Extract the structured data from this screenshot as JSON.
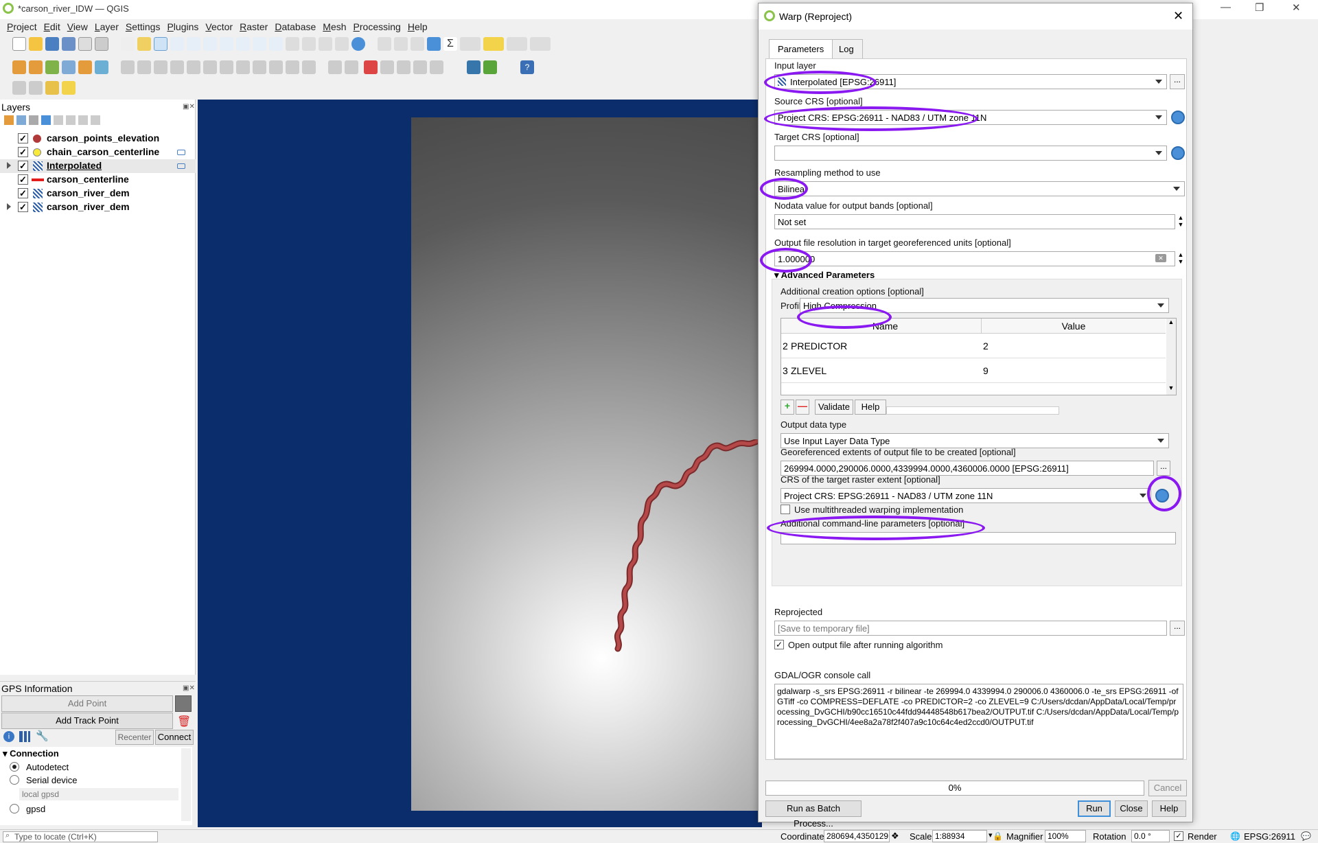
{
  "window": {
    "title": "*carson_river_IDW — QGIS"
  },
  "menubar": [
    "Project",
    "Edit",
    "View",
    "Layer",
    "Settings",
    "Plugins",
    "Vector",
    "Raster",
    "Database",
    "Mesh",
    "Processing",
    "Help"
  ],
  "layers_panel": {
    "title": "Layers",
    "items": [
      {
        "label": "carson_points_elevation",
        "checked": "✓",
        "symbol": "point-red-icon"
      },
      {
        "label": "chain_carson_centerline",
        "checked": "✓",
        "symbol": "point-yellow-icon"
      },
      {
        "label": "Interpolated",
        "checked": "✓",
        "symbol": "raster-icon"
      },
      {
        "label": "carson_centerline",
        "checked": "✓",
        "symbol": "line-red-icon"
      },
      {
        "label": "carson_river_dem",
        "checked": "✓",
        "symbol": "raster-icon"
      },
      {
        "label": "carson_river_dem",
        "checked": "✓",
        "symbol": "raster-icon"
      }
    ]
  },
  "gps_panel": {
    "title": "GPS Information",
    "add_point": "Add Point",
    "add_track_point": "Add Track Point",
    "recenter": "Recenter",
    "connect": "Connect",
    "connection_header": "Connection",
    "autodetect": "Autodetect",
    "serial_device": "Serial device",
    "local_gpsd": "local gpsd",
    "gpsd": "gpsd"
  },
  "statusbar": {
    "locate_placeholder": "Type to locate (Ctrl+K)",
    "coordinate_label": "Coordinate",
    "coordinate_value": "280694,4350129",
    "scale_label": "Scale",
    "scale_value": "1:88934",
    "magnifier_label": "Magnifier",
    "magnifier_value": "100%",
    "rotation_label": "Rotation",
    "rotation_value": "0.0 °",
    "render_label": "Render",
    "crs": "EPSG:26911"
  },
  "dialog": {
    "title": "Warp (Reproject)",
    "tabs": [
      "Parameters",
      "Log"
    ],
    "input_layer_label": "Input layer",
    "input_layer_value": "Interpolated [EPSG:26911]",
    "source_crs_label": "Source CRS [optional]",
    "source_crs_value": "Project CRS: EPSG:26911 - NAD83 / UTM zone 11N",
    "target_crs_label": "Target CRS [optional]",
    "target_crs_value": "",
    "resampling_label": "Resampling method to use",
    "resampling_value": "Bilinear",
    "nodata_label": "Nodata value for output bands [optional]",
    "nodata_value": "Not set",
    "resolution_label": "Output file resolution in target georeferenced units [optional]",
    "resolution_value": "1.000000",
    "advanced_label": "Advanced Parameters",
    "creation_options_label": "Additional creation options [optional]",
    "profile_label": "Profile",
    "profile_value": "High Compression",
    "table_headers": [
      "Name",
      "Value"
    ],
    "table_rows": [
      {
        "idx": "2",
        "name": "PREDICTOR",
        "value": "2"
      },
      {
        "idx": "3",
        "name": "ZLEVEL",
        "value": "9"
      }
    ],
    "validate": "Validate",
    "help_small": "Help",
    "output_type_label": "Output data type",
    "output_type_value": "Use Input Layer Data Type",
    "extent_label": "Georeferenced extents of output file to be created [optional]",
    "extent_value": "269994.0000,290006.0000,4339994.0000,4360006.0000 [EPSG:26911]",
    "extent_crs_label": "CRS of the target raster extent [optional]",
    "extent_crs_value": "Project CRS: EPSG:26911 - NAD83 / UTM zone 11N",
    "multithread_label": "Use multithreaded warping implementation",
    "extra_params_label": "Additional command-line parameters [optional]",
    "reprojected_label": "Reprojected",
    "reprojected_placeholder": "[Save to temporary file]",
    "open_after_label": "Open output file after running algorithm",
    "console_label": "GDAL/OGR console call",
    "console_text": "gdalwarp -s_srs EPSG:26911 -r bilinear -te 269994.0 4339994.0 290006.0 4360006.0 -te_srs EPSG:26911 -of GTiff -co COMPRESS=DEFLATE -co PREDICTOR=2 -co ZLEVEL=9 C:/Users/dcdan/AppData/Local/Temp/processing_DvGCHI/b90cc16510c44fdd94448548b617bea2/OUTPUT.tif C:/Users/dcdan/AppData/Local/Temp/processing_DvGCHI/4ee8a2a78f2f407a9c10c64c4ed2ccd0/OUTPUT.tif",
    "progress": "0%",
    "cancel": "Cancel",
    "batch": "Run as Batch Process...",
    "run": "Run",
    "close": "Close",
    "help": "Help"
  }
}
